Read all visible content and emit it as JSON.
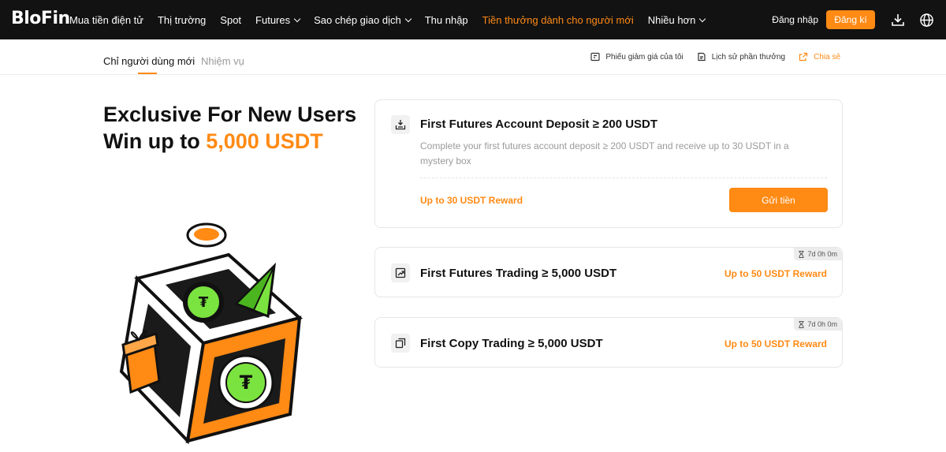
{
  "brand": {
    "logo": "BloFin",
    "accent_color": "#ff8a14",
    "nav_bg": "#121212"
  },
  "nav": {
    "items": [
      {
        "label": "Mua tiền điện tử",
        "dropdown": false,
        "highlight": false
      },
      {
        "label": "Thị trường",
        "dropdown": false,
        "highlight": false
      },
      {
        "label": "Spot",
        "dropdown": false,
        "highlight": false
      },
      {
        "label": "Futures",
        "dropdown": true,
        "highlight": false
      },
      {
        "label": "Sao chép giao dịch",
        "dropdown": true,
        "highlight": false
      },
      {
        "label": "Thu nhập",
        "dropdown": false,
        "highlight": false
      },
      {
        "label": "Tiền thưởng dành cho người mới",
        "dropdown": false,
        "highlight": true
      },
      {
        "label": "Nhiều hơn",
        "dropdown": true,
        "highlight": false
      }
    ],
    "login": "Đăng nhập",
    "signup": "Đăng kí",
    "download_icon": "download-icon",
    "language_icon": "globe-icon"
  },
  "subnav": {
    "tabs": [
      {
        "label": "Chỉ người dùng mới",
        "active": true
      },
      {
        "label": "Nhiệm vụ",
        "active": false
      }
    ],
    "links": [
      {
        "label": "Phiếu giảm giá của tôi",
        "icon": "coupon-icon"
      },
      {
        "label": "Lịch sử phần thưởng",
        "icon": "history-icon"
      },
      {
        "label": "Chia sẻ",
        "icon": "share-icon"
      }
    ]
  },
  "hero": {
    "line1": "Exclusive For New Users",
    "line2_prefix": "Win up to ",
    "line2_amount": "5,000 USDT"
  },
  "tasks": [
    {
      "icon": "deposit-icon",
      "title": "First Futures Account Deposit ≥ 200 USDT",
      "description": "Complete your first futures account deposit ≥ 200 USDT and receive up to 30 USDT in a mystery box",
      "reward": "Up to 30 USDT Reward",
      "button": "Gửi tiền"
    },
    {
      "icon": "trading-icon",
      "title": "First Futures Trading ≥ 5,000 USDT",
      "reward": "Up to 50 USDT Reward",
      "timer": "7d 0h 0m"
    },
    {
      "icon": "copy-icon",
      "title": "First Copy Trading ≥ 5,000 USDT",
      "reward": "Up to 50 USDT Reward",
      "timer": "7d 0h 0m"
    }
  ]
}
